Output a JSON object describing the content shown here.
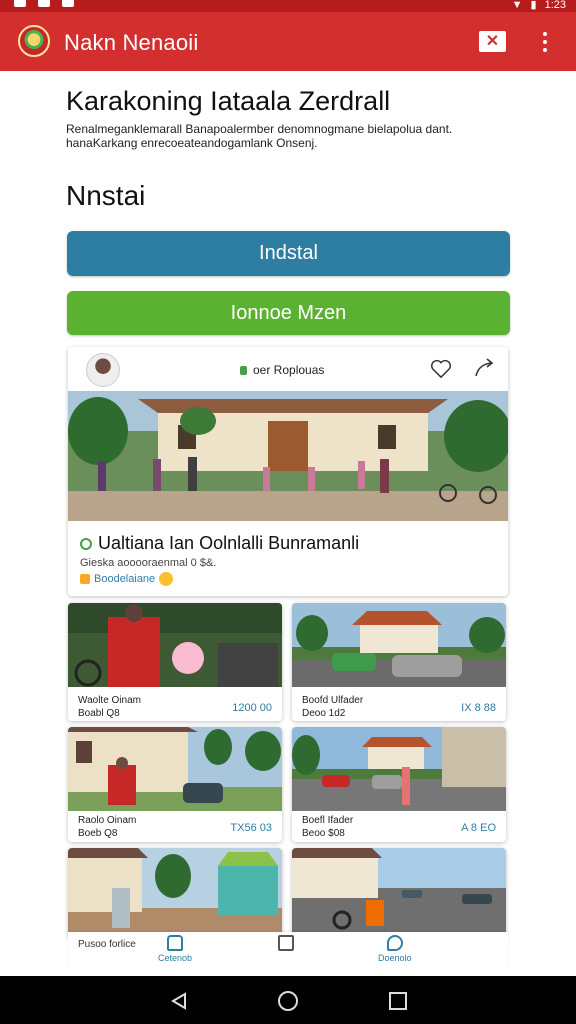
{
  "status_bar": {
    "time": "1:23",
    "battery_icon": "battery-icon",
    "wifi_icon": "wifi-icon"
  },
  "app_bar": {
    "title": "Nakn Nenaoii",
    "close_icon": "close-icon",
    "more_icon": "more-vert-icon"
  },
  "page": {
    "title": "Karakoning Iataala Zerdrall",
    "description": "Renalmeganklemarall Banapoalermber denomnogmane bielapolua dant. hanaKarkang enrecoeateandogamlank Onsenj.",
    "section_title": "Nnstai"
  },
  "buttons": {
    "install_label": "Indstal",
    "more_label": "Ionnoe Mzen",
    "install_color": "#2e7ea2",
    "more_color": "#5bb131"
  },
  "featured": {
    "tag": "oer Roplouas",
    "caption": "Ualtiana Ian Oolnlalli Bunramanli",
    "meta": "Gieska aooooraenmal 0 $&.",
    "link": "Boodelaiane"
  },
  "tiles": [
    {
      "name": "Waolte Oinam",
      "sub": "Boabl Q8",
      "price": "1200 00"
    },
    {
      "name": "Boofd Ulfader",
      "sub": "Deoo 1d2",
      "price": "IX 8 88"
    },
    {
      "name": "Raolo Oinam",
      "sub": "Boeb Q8",
      "price": "TX56 03"
    },
    {
      "name": "Boefl Ifader",
      "sub": "Beoo $08",
      "price": "A 8 EO"
    }
  ],
  "bottom_nav": {
    "label": "Pusoo forlice",
    "items": [
      {
        "label": "Cetenob",
        "icon": "home-icon"
      },
      {
        "label": "",
        "icon": "edit-icon"
      },
      {
        "label": "Doenolo",
        "icon": "chat-icon"
      }
    ]
  }
}
